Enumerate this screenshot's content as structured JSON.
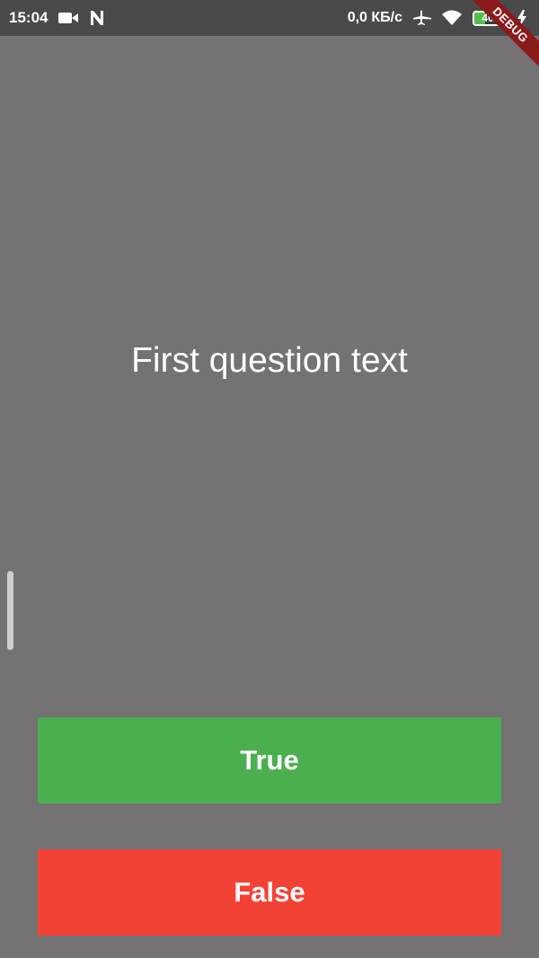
{
  "status_bar": {
    "time": "15:04",
    "speed": "0,0 КБ/с",
    "battery": "40",
    "icons": [
      "video-camera-icon",
      "n-notification-icon",
      "airplane-icon",
      "wifi-icon",
      "battery-icon",
      "charging-icon"
    ]
  },
  "debug_banner": {
    "label": "DEBUG"
  },
  "question": {
    "text": "First question text"
  },
  "buttons": {
    "true_label": "True",
    "false_label": "False"
  },
  "colors": {
    "background": "#747273",
    "status_bar": "#4a4a4a",
    "true_button": "#4bae4f",
    "false_button": "#f34235",
    "debug_ribbon": "#8b1a1a",
    "battery_fill": "#57c04a"
  }
}
